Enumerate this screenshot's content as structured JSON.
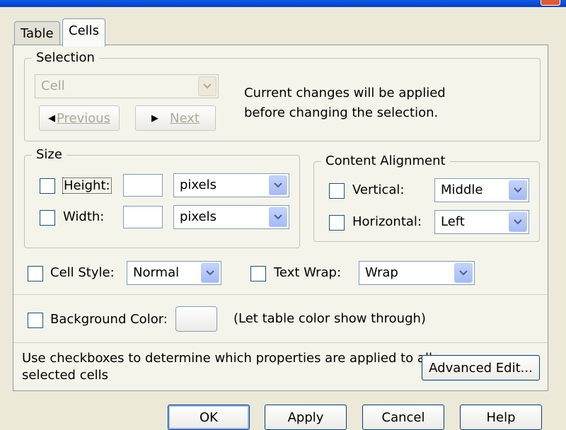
{
  "tabs": [
    "Table",
    "Cells"
  ],
  "selection": {
    "legend": "Selection",
    "combo_value": "Cell",
    "previous_label": "Previous",
    "next_label": "Next",
    "note_line1": "Current changes will be applied",
    "note_line2": "before changing the selection."
  },
  "size": {
    "legend": "Size",
    "height_label": "Height:",
    "width_label": "Width:",
    "height_value": "",
    "width_value": "",
    "height_unit": "pixels",
    "width_unit": "pixels"
  },
  "alignment": {
    "legend": "Content Alignment",
    "vertical_label": "Vertical:",
    "vertical_value": "Middle",
    "horizontal_label": "Horizontal:",
    "horizontal_value": "Left"
  },
  "cell_style": {
    "label": "Cell Style:",
    "value": "Normal"
  },
  "text_wrap": {
    "label": "Text Wrap:",
    "value": "Wrap"
  },
  "background": {
    "label": "Background Color:",
    "note": "(Let table color show through)"
  },
  "help_text_line1": "Use checkboxes to determine which properties are applied to all",
  "help_text_line2": "selected cells",
  "advanced_edit_label": "Advanced Edit...",
  "footer": {
    "ok": "OK",
    "apply": "Apply",
    "cancel": "Cancel",
    "help": "Help"
  },
  "colors": {
    "accent": "#0a3fbf",
    "dialog_bg": "#ece9d8",
    "panel_bg": "#f5f4ea",
    "field_border": "#7f9db9"
  }
}
